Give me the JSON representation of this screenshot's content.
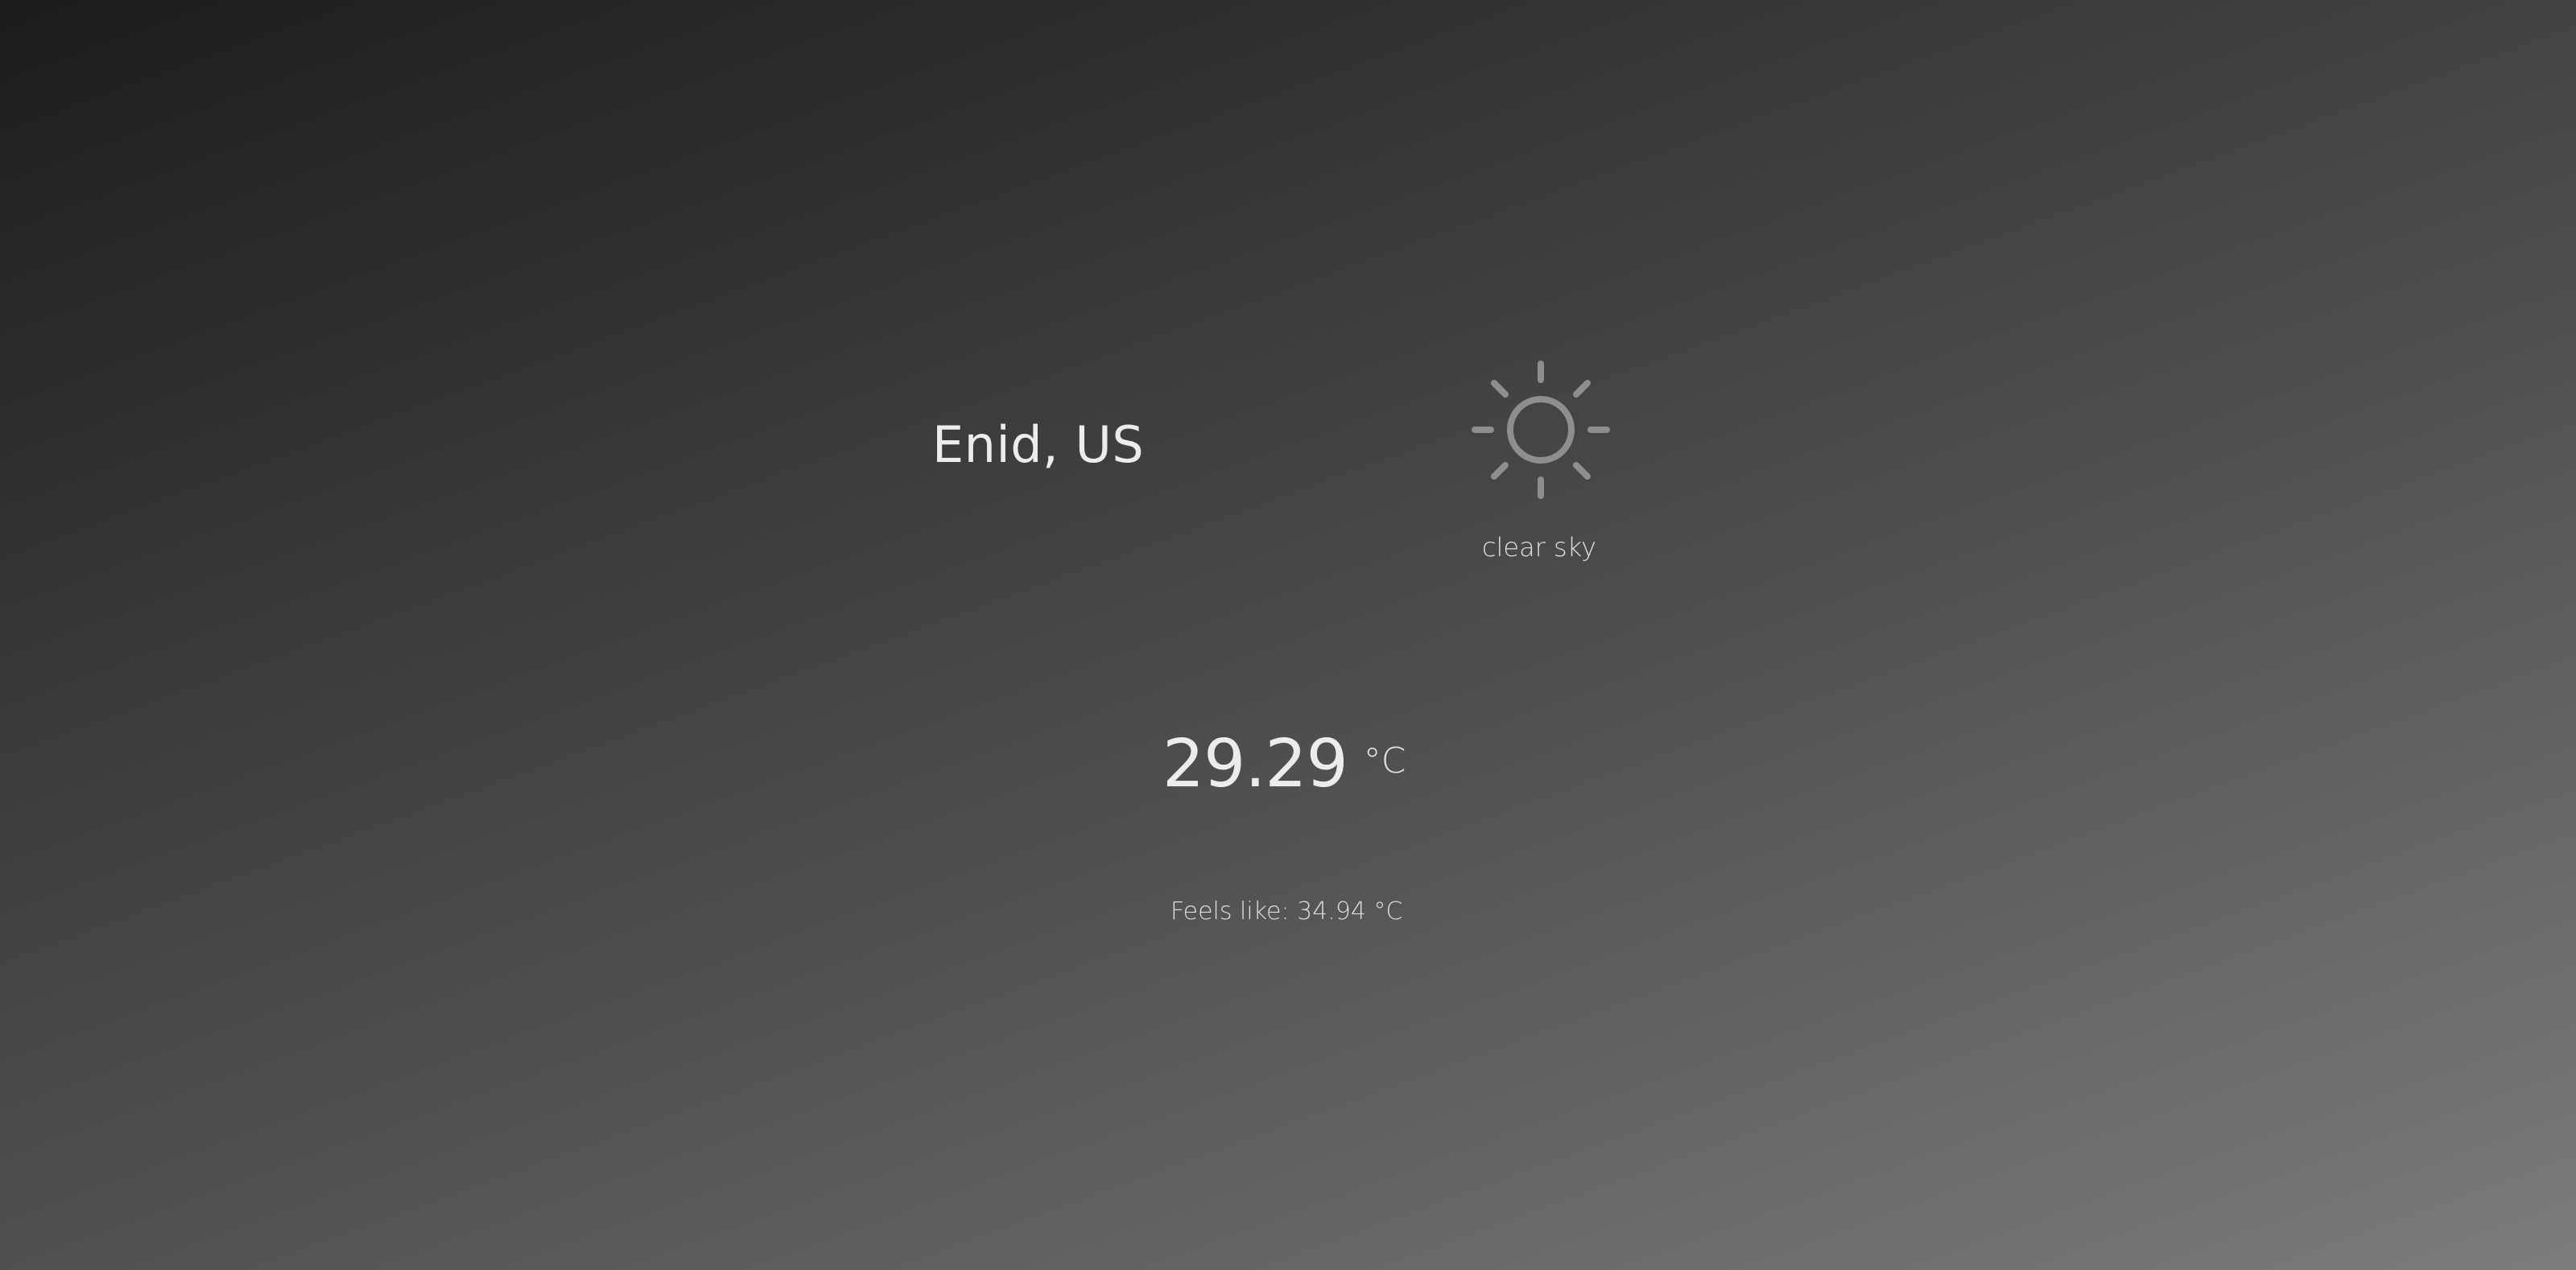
{
  "location": {
    "city": "Enid, US"
  },
  "weather": {
    "icon": "sun-icon",
    "condition": "clear sky",
    "icon_color": "#8e8e8e"
  },
  "temperature": {
    "value": "29.29",
    "unit": "°C",
    "feels_like": "Feels like: 34.94 °C"
  },
  "colors": {
    "text": "#ececec",
    "background_start": "#1c1c1c",
    "background_end": "#7c7c7c"
  }
}
